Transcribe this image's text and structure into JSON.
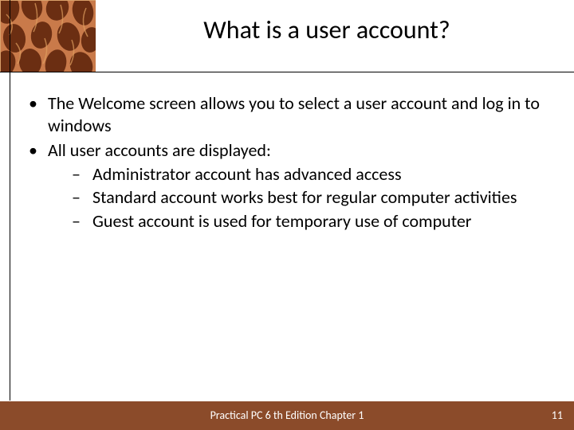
{
  "title": "What is a user account?",
  "bullets": {
    "b1": "The Welcome screen allows you to select a user account and log in to windows",
    "b2": "All user accounts are displayed:",
    "sub1": "Administrator account has advanced access",
    "sub2": "Standard account works best for regular computer activities",
    "sub3": "Guest account is used for temporary use of computer"
  },
  "footer": "Practical PC 6 th Edition Chapter 1",
  "page_number": "11",
  "colors": {
    "footer_bg": "#8b4b2a"
  }
}
